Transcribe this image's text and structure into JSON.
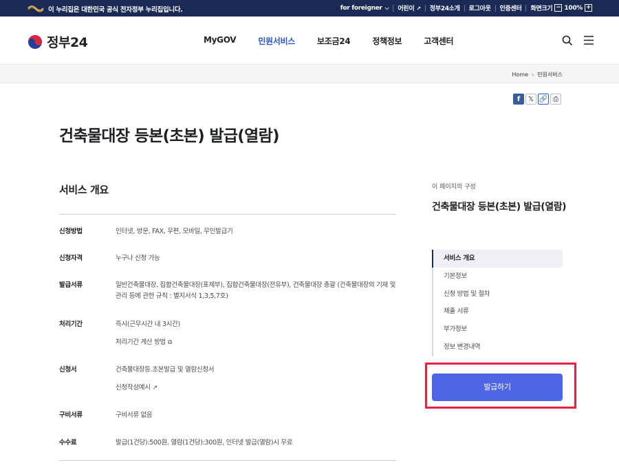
{
  "topbar": {
    "notice": "이 누리집은 대한민국 공식 전자정부 누리집입니다.",
    "foreigner": "for foreigner",
    "kids": "어린이",
    "about": "정부24소개",
    "logout": "로그아웃",
    "cert": "인증센터",
    "screen_size": "화면크기",
    "zoom_minus": "−",
    "zoom_value": "100%",
    "zoom_plus": "+"
  },
  "header": {
    "logo": "정부24",
    "nav": [
      "MyGOV",
      "민원서비스",
      "보조금24",
      "정책정보",
      "고객센터"
    ],
    "active_nav": "민원서비스"
  },
  "breadcrumb": {
    "home": "Home",
    "current": "민원서비스"
  },
  "page": {
    "title": "건축물대장 등본(초본) 발급(열람)"
  },
  "overview": {
    "title": "서비스 개요",
    "rows": [
      {
        "label": "신청방법",
        "value": "인터넷, 방문, FAX, 우편, 모바일, 무인발급기"
      },
      {
        "label": "신청자격",
        "value": "누구나 신청 가능"
      },
      {
        "label": "발급서류",
        "value": "일반건축물대장, 집합건축물대장(표제부), 집합건축물대장(전유부), 건축물대장 총괄 (건축물대장의 기재 및 관리 등에 관한 규칙 : 별지서식 1,3,5,7호)"
      },
      {
        "label": "처리기간",
        "value": "즉시(근무시간 내 3시간)",
        "sub": "처리기간 계산 방법"
      },
      {
        "label": "신청서",
        "value": "건축물대장등.초본발급 및 열람신청서",
        "sub": "신청작성예시"
      },
      {
        "label": "구비서류",
        "value": "구비서류 없음"
      },
      {
        "label": "수수료",
        "value": "발급(1건당):500원, 열람(1건당):300원, 인터넷 발급(열람)시 무료"
      }
    ]
  },
  "toc": {
    "caption": "이 페이지의 구성",
    "title": "건축물대장 등본(초본) 발급(열람)",
    "items": [
      "서비스 개요",
      "기본정보",
      "신청 방법 및 절차",
      "제출 서류",
      "부가정보",
      "정보 변경내역"
    ]
  },
  "apply_button": "발급하기",
  "colors": {
    "topbar_bg": "#1b2a55",
    "accent": "#2b55d6",
    "button": "#4c66e6",
    "highlight": "#e8223e"
  }
}
